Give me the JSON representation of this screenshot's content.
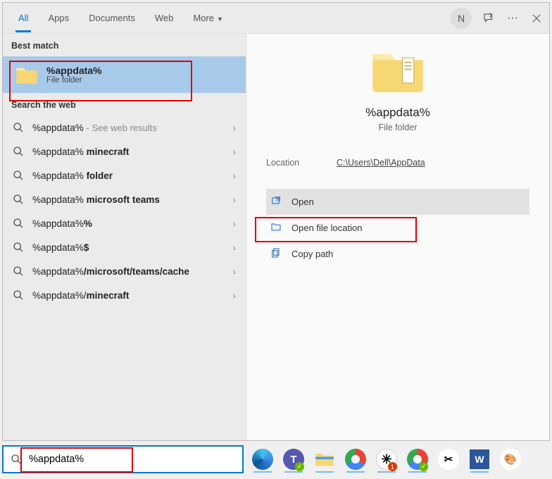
{
  "header": {
    "tabs": [
      "All",
      "Apps",
      "Documents",
      "Web",
      "More"
    ],
    "avatar_initial": "N"
  },
  "left": {
    "best_match_label": "Best match",
    "best_match": {
      "title": "%appdata%",
      "sub": "File folder"
    },
    "search_web_label": "Search the web",
    "web_items": [
      {
        "prefix": "%appdata%",
        "bold": "",
        "sub": " - See web results"
      },
      {
        "prefix": "%appdata%",
        "bold": " minecraft",
        "sub": ""
      },
      {
        "prefix": "%appdata%",
        "bold": " folder",
        "sub": ""
      },
      {
        "prefix": "%appdata%",
        "bold": " microsoft teams",
        "sub": ""
      },
      {
        "prefix": "%appdata%",
        "bold": "%",
        "sub": ""
      },
      {
        "prefix": "%appdata%",
        "bold": "$",
        "sub": ""
      },
      {
        "prefix": "%appdata%",
        "bold": "/microsoft/teams/cache",
        "sub": ""
      },
      {
        "prefix": "%appdata%/",
        "bold": "minecraft",
        "sub": ""
      }
    ]
  },
  "right": {
    "title": "%appdata%",
    "sub": "File folder",
    "location_label": "Location",
    "location_value": "C:\\Users\\Dell\\AppData",
    "actions": [
      {
        "label": "Open",
        "icon": "open"
      },
      {
        "label": "Open file location",
        "icon": "location"
      },
      {
        "label": "Copy path",
        "icon": "copy"
      }
    ]
  },
  "search": {
    "value": "%appdata%"
  },
  "taskbar": {
    "items": [
      "edge",
      "teams",
      "explorer",
      "chrome",
      "slack",
      "chrome2",
      "snip",
      "word",
      "paint"
    ]
  }
}
